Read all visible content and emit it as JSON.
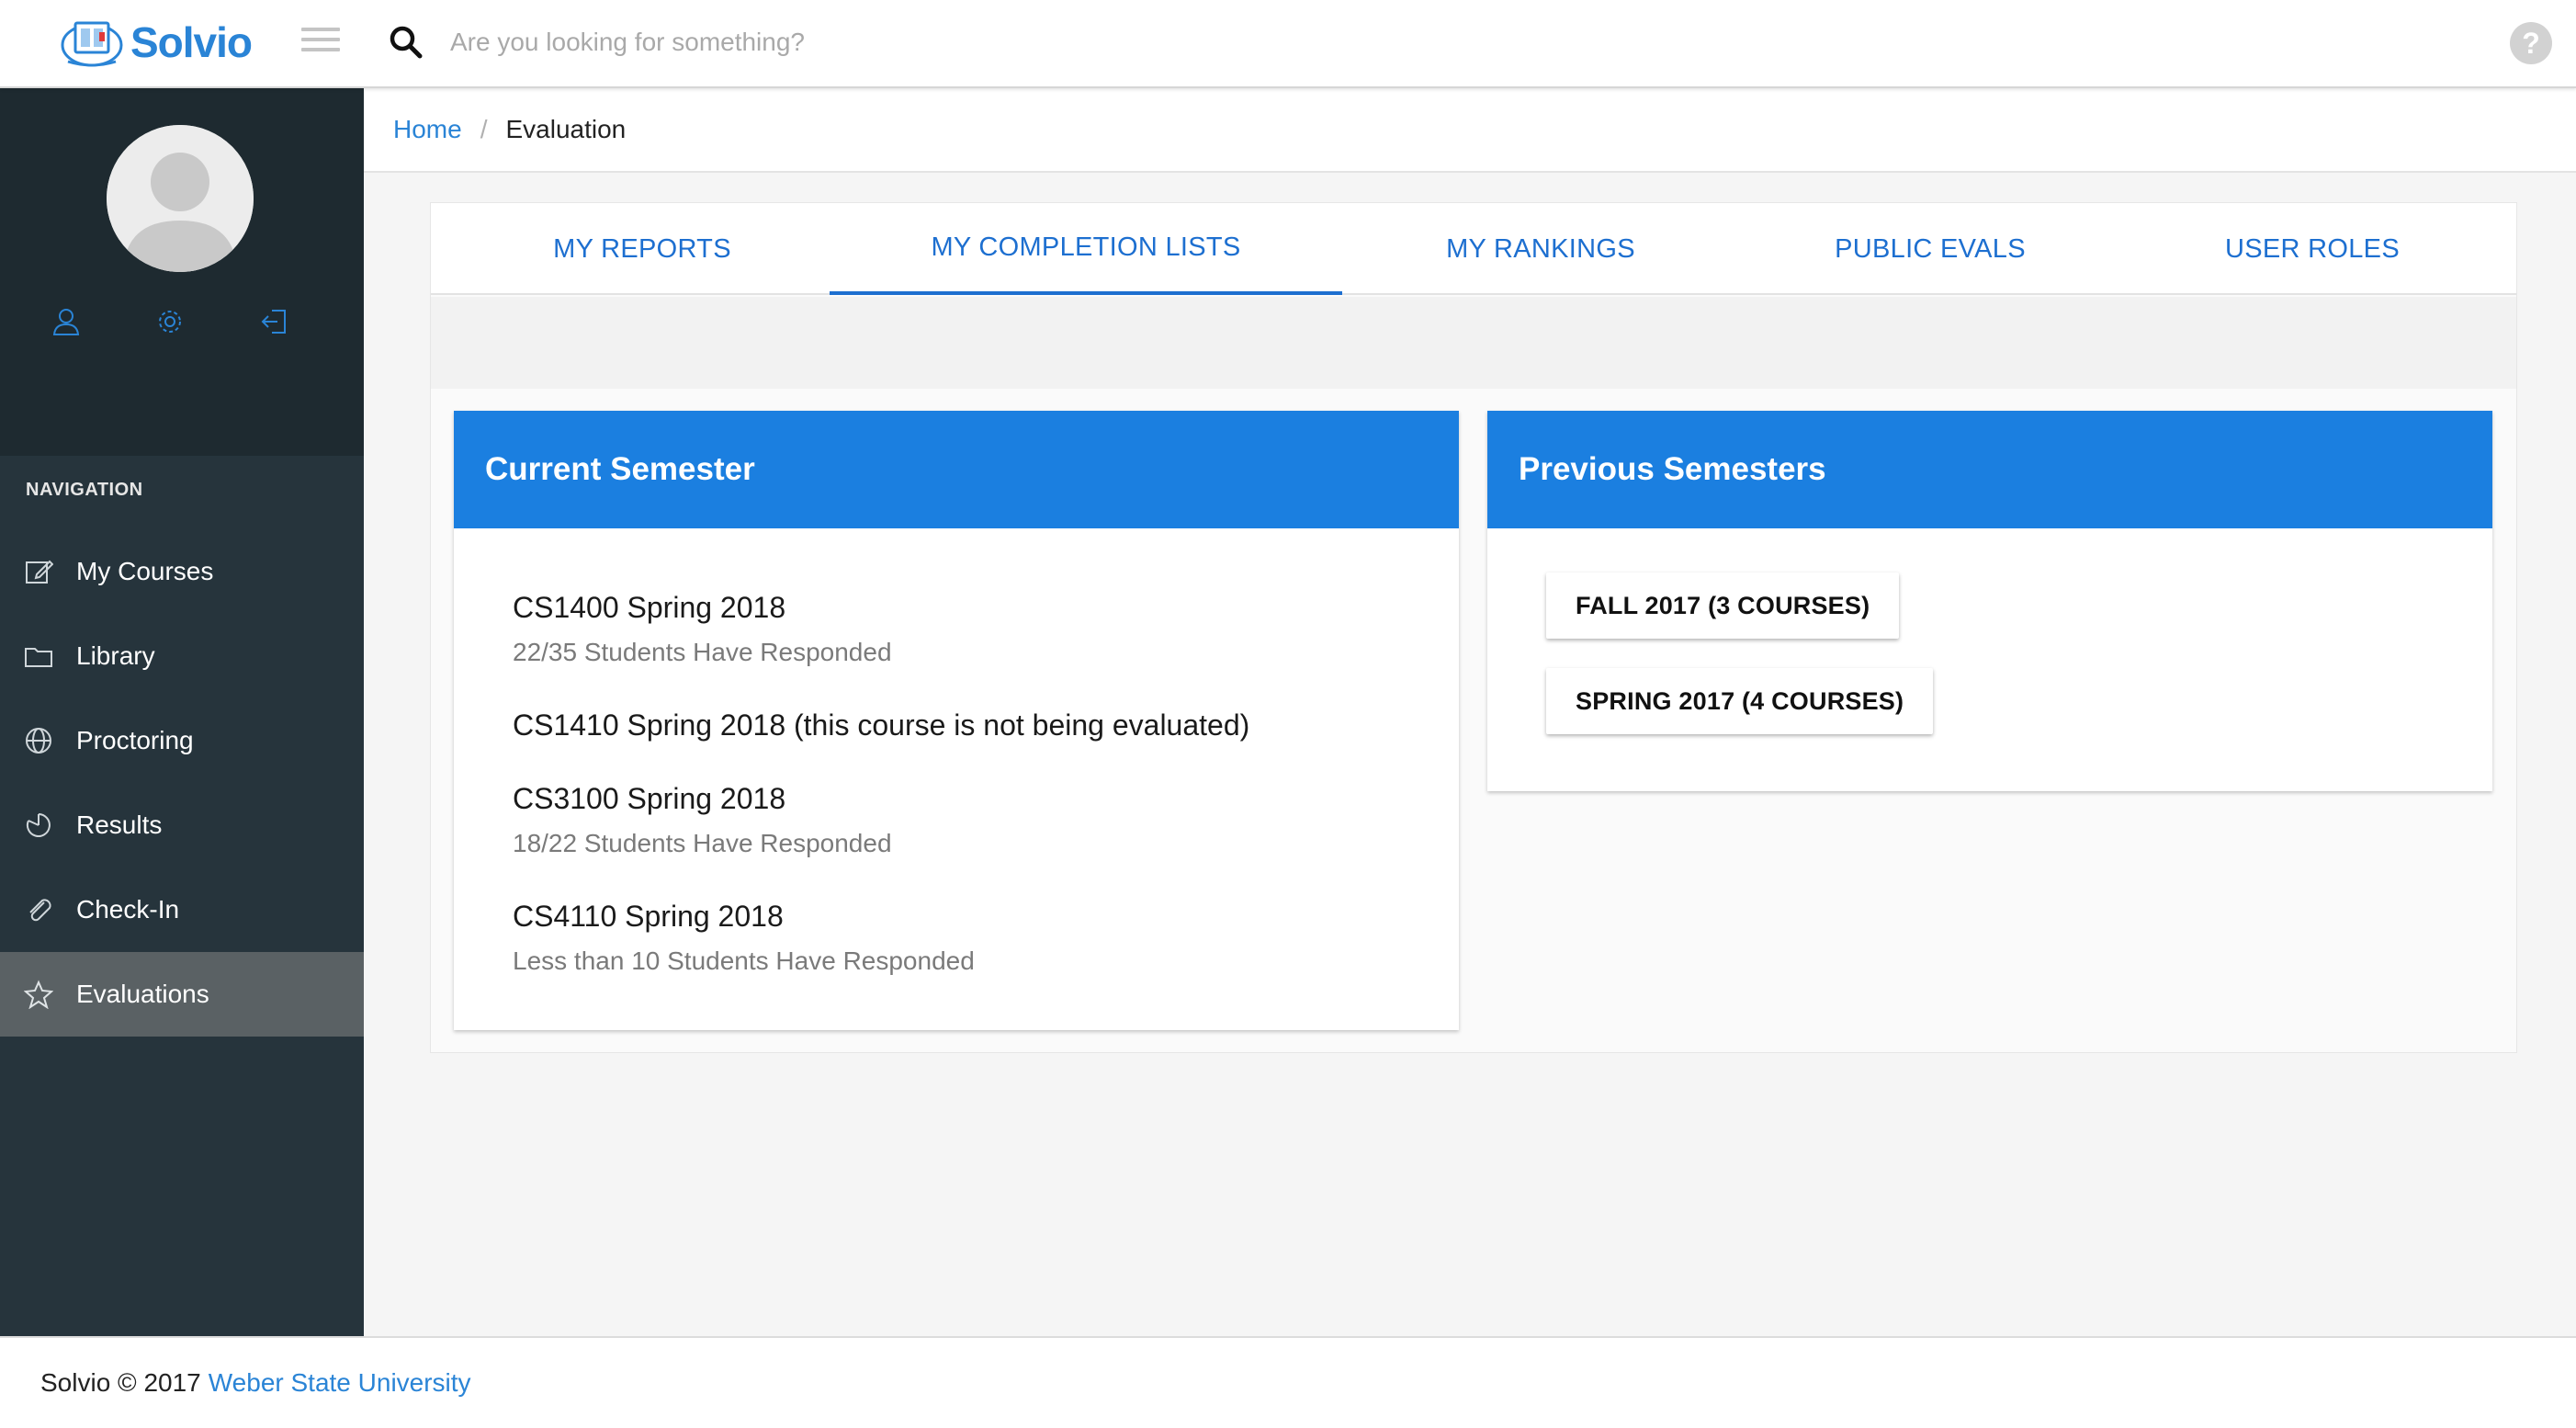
{
  "app": {
    "name": "Solvio",
    "brand_color": "#2a84d6",
    "accent_color": "#1b7fe0"
  },
  "header": {
    "search_placeholder": "Are you looking for something?",
    "icons": [
      "menu-icon",
      "search-icon",
      "help-icon"
    ]
  },
  "sidebar": {
    "profile_actions": [
      "user-icon",
      "gear-icon",
      "logout-icon"
    ],
    "nav_heading": "NAVIGATION",
    "items": [
      {
        "label": "My Courses",
        "icon": "edit-icon",
        "active": false
      },
      {
        "label": "Library",
        "icon": "folder-icon",
        "active": false
      },
      {
        "label": "Proctoring",
        "icon": "globe-icon",
        "active": false
      },
      {
        "label": "Results",
        "icon": "chart-pie-icon",
        "active": false
      },
      {
        "label": "Check-In",
        "icon": "paperclip-icon",
        "active": false
      },
      {
        "label": "Evaluations",
        "icon": "star-icon",
        "active": true
      }
    ]
  },
  "breadcrumb": {
    "home": "Home",
    "separator": "/",
    "current": "Evaluation"
  },
  "tabs": [
    {
      "label": "MY REPORTS",
      "active": false
    },
    {
      "label": "MY COMPLETION LISTS",
      "active": true
    },
    {
      "label": "MY RANKINGS",
      "active": false
    },
    {
      "label": "PUBLIC EVALS",
      "active": false
    },
    {
      "label": "USER ROLES",
      "active": false
    }
  ],
  "current_semester": {
    "title": "Current Semester",
    "courses": [
      {
        "title": "CS1400 Spring 2018",
        "status": "22/35 Students Have Responded"
      },
      {
        "title": "CS1410 Spring 2018 (this course is not being evaluated)",
        "status": ""
      },
      {
        "title": "CS3100 Spring 2018",
        "status": "18/22 Students Have Responded"
      },
      {
        "title": "CS4110 Spring 2018",
        "status": "Less than 10 Students Have Responded"
      }
    ]
  },
  "previous_semesters": {
    "title": "Previous Semesters",
    "buttons": [
      "FALL 2017 (3 COURSES)",
      "SPRING 2017 (4 COURSES)"
    ]
  },
  "footer": {
    "text": "Solvio © 2017",
    "link": "Weber State University"
  }
}
